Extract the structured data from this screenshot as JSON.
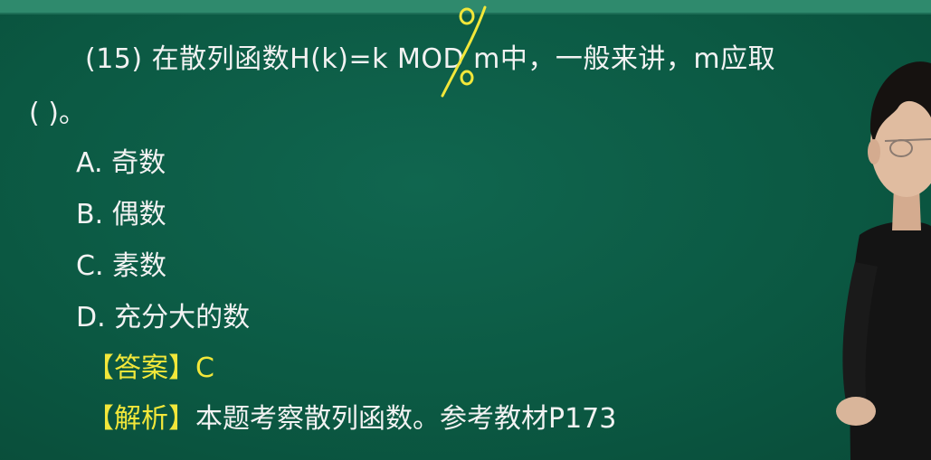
{
  "question": {
    "line1": "(15) 在散列函数H(k)=k MOD m中，一般来讲，m应取",
    "line2": "(    )。"
  },
  "options": [
    "A. 奇数",
    "B. 偶数",
    "C. 素数",
    "D. 充分大的数"
  ],
  "answer": {
    "label": "【答案】",
    "value": "C"
  },
  "analysis": {
    "label": "【解析】",
    "text": "本题考察散列函数。参考教材P173"
  },
  "annotation": {
    "handwritten_mark": "%"
  },
  "colors": {
    "board": "#0d5a45",
    "text": "#f2f2f2",
    "highlight": "#f2e73a"
  }
}
